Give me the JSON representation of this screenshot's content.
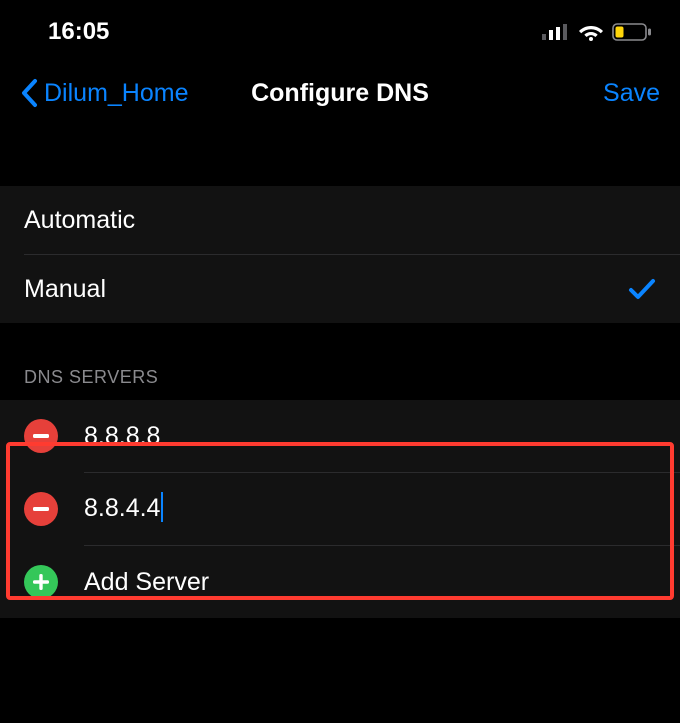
{
  "status": {
    "time": "16:05"
  },
  "nav": {
    "back_label": "Dilum_Home",
    "title": "Configure DNS",
    "save_label": "Save"
  },
  "mode": {
    "automatic_label": "Automatic",
    "manual_label": "Manual",
    "selected": "manual"
  },
  "dns": {
    "section_header": "DNS SERVERS",
    "servers": [
      "8.8.8.8",
      "8.8.4.4"
    ],
    "add_label": "Add Server",
    "editing_index": 1
  },
  "colors": {
    "accent": "#0a84ff",
    "remove": "#e6403a",
    "add": "#34c759",
    "highlight": "#ff3b30"
  }
}
